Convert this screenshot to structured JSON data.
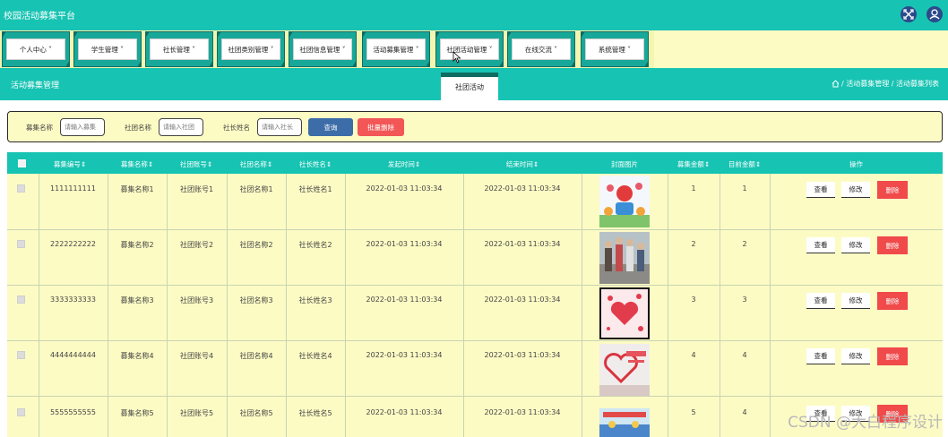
{
  "header": {
    "title": "校园活动募集平台"
  },
  "nav": {
    "items": [
      "个人中心",
      "学生管理",
      "社长管理",
      "社团类别管理",
      "社团信息管理",
      "活动募集管理",
      "社团活动管理",
      "在线交流",
      "系统管理"
    ]
  },
  "subheader": {
    "title": "活动募集管理",
    "active_tab": "社团活动",
    "breadcrumb": "/ 活动募集管理 / 活动募集列表"
  },
  "search": {
    "fields": [
      {
        "label": "募集名称",
        "placeholder": "请输入募集"
      },
      {
        "label": "社团名称",
        "placeholder": "请输入社团"
      },
      {
        "label": "社长姓名",
        "placeholder": "请输入社长"
      }
    ],
    "search_label": "查询",
    "bulk_delete_label": "批量删除"
  },
  "table": {
    "columns": [
      "募集编号",
      "募集名称",
      "社团账号",
      "社团名称",
      "社长姓名",
      "发起时间",
      "结束时间",
      "封面图片",
      "募集金额",
      "目前金额",
      "操作"
    ],
    "rows": [
      {
        "code": "1111111111",
        "name": "募集名称1",
        "account": "社团账号1",
        "club": "社团名称1",
        "leader": "社长姓名1",
        "start": "2022-01-03 11:03:34",
        "end": "2022-01-03 11:03:34",
        "amount": "1",
        "current": "1"
      },
      {
        "code": "2222222222",
        "name": "募集名称2",
        "account": "社团账号2",
        "club": "社团名称2",
        "leader": "社长姓名2",
        "start": "2022-01-03 11:03:34",
        "end": "2022-01-03 11:03:34",
        "amount": "2",
        "current": "2"
      },
      {
        "code": "3333333333",
        "name": "募集名称3",
        "account": "社团账号3",
        "club": "社团名称3",
        "leader": "社长姓名3",
        "start": "2022-01-03 11:03:34",
        "end": "2022-01-03 11:03:34",
        "amount": "3",
        "current": "3"
      },
      {
        "code": "4444444444",
        "name": "募集名称4",
        "account": "社团账号4",
        "club": "社团名称4",
        "leader": "社长姓名4",
        "start": "2022-01-03 11:03:34",
        "end": "2022-01-03 11:03:34",
        "amount": "4",
        "current": "4"
      },
      {
        "code": "5555555555",
        "name": "募集名称5",
        "account": "社团账号5",
        "club": "社团名称5",
        "leader": "社长姓名5",
        "start": "2022-01-03 11:03:34",
        "end": "2022-01-03 11:03:34",
        "amount": "5",
        "current": "4"
      }
    ],
    "actions": {
      "view": "查看",
      "edit": "修改",
      "delete": "删除"
    }
  },
  "watermark": "CSDN @大白程序设计",
  "icons": {
    "fullscreen": "expand-icon",
    "user": "user-icon",
    "home": "home-icon",
    "sort": "sort-icon"
  },
  "colors": {
    "primary": "#17c3b2",
    "panel": "#fcfbc4",
    "search": "#3d6da8",
    "danger": "#f25656"
  }
}
